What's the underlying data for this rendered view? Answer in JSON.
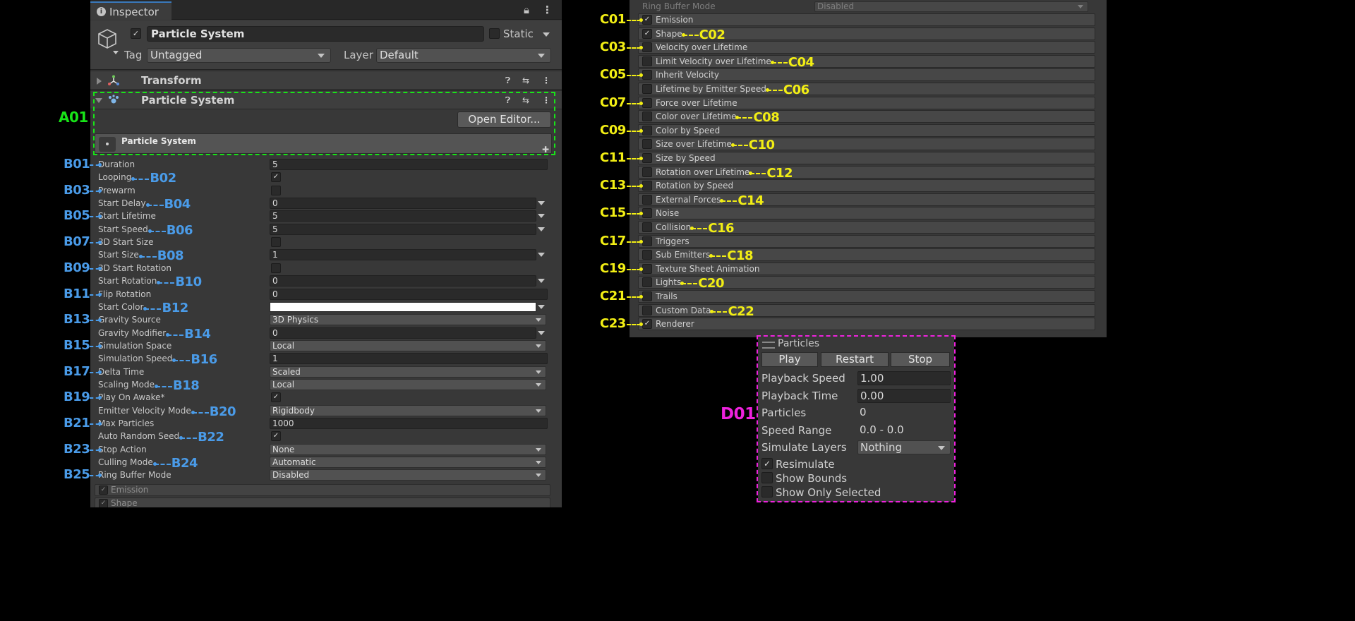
{
  "inspector": {
    "tab_label": "Inspector",
    "object_name": "Particle System",
    "static_label": "Static",
    "tag_label": "Tag",
    "tag_value": "Untagged",
    "layer_label": "Layer",
    "layer_value": "Default",
    "transform_title": "Transform",
    "ps_title": "Particle System",
    "open_editor_label": "Open Editor...",
    "ps_header_title": "Particle System"
  },
  "properties": [
    {
      "label": "Duration",
      "type": "field",
      "value": "5"
    },
    {
      "label": "Looping",
      "type": "checkbox",
      "checked": true
    },
    {
      "label": "Prewarm",
      "type": "checkbox",
      "checked": false
    },
    {
      "label": "Start Delay",
      "type": "curvefield",
      "value": "0"
    },
    {
      "label": "Start Lifetime",
      "type": "curvefield",
      "value": "5"
    },
    {
      "label": "Start Speed",
      "type": "curvefield",
      "value": "5"
    },
    {
      "label": "3D Start Size",
      "type": "checkbox",
      "checked": false
    },
    {
      "label": "Start Size",
      "type": "curvefield",
      "value": "1"
    },
    {
      "label": "3D Start Rotation",
      "type": "checkbox",
      "checked": false
    },
    {
      "label": "Start Rotation",
      "type": "curvefield",
      "value": "0"
    },
    {
      "label": "Flip Rotation",
      "type": "field",
      "value": "0"
    },
    {
      "label": "Start Color",
      "type": "color",
      "value": "#FFFFFF"
    },
    {
      "label": "Gravity Source",
      "type": "dropdown",
      "value": "3D Physics"
    },
    {
      "label": "Gravity Modifier",
      "type": "curvefield",
      "value": "0"
    },
    {
      "label": "Simulation Space",
      "type": "dropdown",
      "value": "Local"
    },
    {
      "label": "Simulation Speed",
      "type": "field",
      "value": "1"
    },
    {
      "label": "Delta Time",
      "type": "dropdown",
      "value": "Scaled"
    },
    {
      "label": "Scaling Mode",
      "type": "dropdown",
      "value": "Local"
    },
    {
      "label": "Play On Awake*",
      "type": "checkbox",
      "checked": true
    },
    {
      "label": "Emitter Velocity Mode",
      "type": "dropdown",
      "value": "Rigidbody"
    },
    {
      "label": "Max Particles",
      "type": "field",
      "value": "1000"
    },
    {
      "label": "Auto Random Seed",
      "type": "checkbox",
      "checked": true
    },
    {
      "label": "Stop Action",
      "type": "dropdown",
      "value": "None"
    },
    {
      "label": "Culling Mode",
      "type": "dropdown",
      "value": "Automatic"
    },
    {
      "label": "Ring Buffer Mode",
      "type": "dropdown",
      "value": "Disabled"
    }
  ],
  "bottom_modules": [
    {
      "label": "Emission",
      "checked": true
    },
    {
      "label": "Shape",
      "checked": true
    }
  ],
  "modules_panel": {
    "ring_buffer_label": "Ring Buffer Mode",
    "ring_buffer_value": "Disabled",
    "modules": [
      {
        "label": "Emission",
        "checked": true
      },
      {
        "label": "Shape",
        "checked": true
      },
      {
        "label": "Velocity over Lifetime",
        "checked": false
      },
      {
        "label": "Limit Velocity over Lifetime",
        "checked": false
      },
      {
        "label": "Inherit Velocity",
        "checked": false
      },
      {
        "label": "Lifetime by Emitter Speed",
        "checked": false
      },
      {
        "label": "Force over Lifetime",
        "checked": false
      },
      {
        "label": "Color over Lifetime",
        "checked": false
      },
      {
        "label": "Color by Speed",
        "checked": false
      },
      {
        "label": "Size over Lifetime",
        "checked": false
      },
      {
        "label": "Size by Speed",
        "checked": false
      },
      {
        "label": "Rotation over Lifetime",
        "checked": false
      },
      {
        "label": "Rotation by Speed",
        "checked": false
      },
      {
        "label": "External Forces",
        "checked": false
      },
      {
        "label": "Noise",
        "checked": false
      },
      {
        "label": "Collision",
        "checked": false
      },
      {
        "label": "Triggers",
        "checked": false
      },
      {
        "label": "Sub Emitters",
        "checked": false
      },
      {
        "label": "Texture Sheet Animation",
        "checked": false
      },
      {
        "label": "Lights",
        "checked": false
      },
      {
        "label": "Trails",
        "checked": false
      },
      {
        "label": "Custom Data",
        "checked": false
      },
      {
        "label": "Renderer",
        "checked": true
      }
    ]
  },
  "particles_overlay": {
    "title": "Particles",
    "buttons": [
      "Play",
      "Restart",
      "Stop"
    ],
    "playback_speed_label": "Playback Speed",
    "playback_speed_value": "1.00",
    "playback_time_label": "Playback Time",
    "playback_time_value": "0.00",
    "particles_label": "Particles",
    "particles_value": "0",
    "speed_range_label": "Speed Range",
    "speed_range_value": "0.0 - 0.0",
    "simulate_layers_label": "Simulate Layers",
    "simulate_layers_value": "Nothing",
    "toggles": [
      {
        "label": "Resimulate",
        "checked": true
      },
      {
        "label": "Show Bounds",
        "checked": false
      },
      {
        "label": "Show Only Selected",
        "checked": false
      }
    ]
  },
  "annotations": {
    "A": [
      "A01"
    ],
    "B": [
      "B01",
      "B02",
      "B03",
      "B04",
      "B05",
      "B06",
      "B07",
      "B08",
      "B09",
      "B10",
      "B11",
      "B12",
      "B13",
      "B14",
      "B15",
      "B16",
      "B17",
      "B18",
      "B19",
      "B20",
      "B21",
      "B22",
      "B23",
      "B24",
      "B25"
    ],
    "C": [
      "C01",
      "C02",
      "C03",
      "C04",
      "C05",
      "C06",
      "C07",
      "C08",
      "C09",
      "C10",
      "C11",
      "C12",
      "C13",
      "C14",
      "C15",
      "C16",
      "C17",
      "C18",
      "C19",
      "C20",
      "C21",
      "C22",
      "C23"
    ],
    "D": [
      "D01"
    ]
  },
  "colors": {
    "label_green": "#18E418",
    "label_blue": "#4A9BE8",
    "label_yellow": "#F2EE14",
    "label_magenta": "#EE22DD",
    "panel_bg": "#383838"
  }
}
